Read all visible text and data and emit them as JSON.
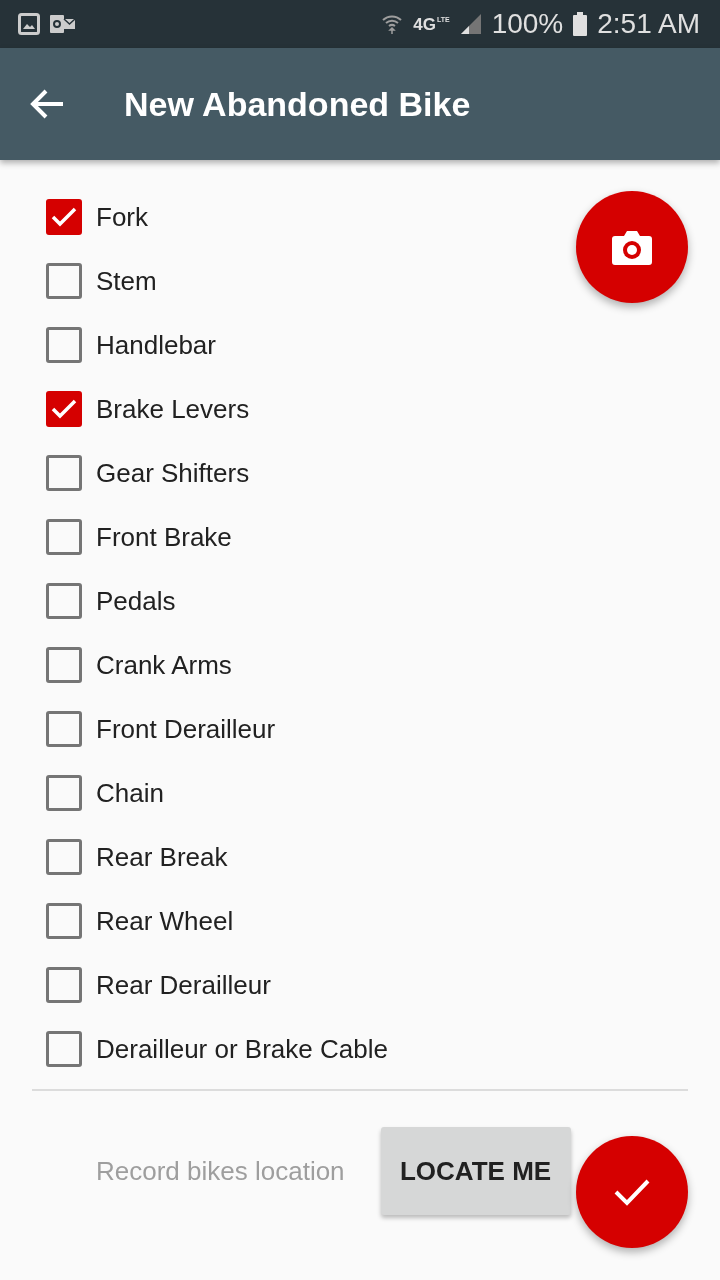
{
  "status_bar": {
    "network": "4G",
    "network_sub": "LTE",
    "battery": "100%",
    "time": "2:51 AM"
  },
  "app_bar": {
    "title": "New Abandoned Bike"
  },
  "parts": [
    {
      "label": "Fork",
      "checked": true
    },
    {
      "label": "Stem",
      "checked": false
    },
    {
      "label": "Handlebar",
      "checked": false
    },
    {
      "label": "Brake Levers",
      "checked": true
    },
    {
      "label": "Gear Shifters",
      "checked": false
    },
    {
      "label": "Front Brake",
      "checked": false
    },
    {
      "label": "Pedals",
      "checked": false
    },
    {
      "label": "Crank Arms",
      "checked": false
    },
    {
      "label": "Front Derailleur",
      "checked": false
    },
    {
      "label": "Chain",
      "checked": false
    },
    {
      "label": "Rear Break",
      "checked": false
    },
    {
      "label": "Rear Wheel",
      "checked": false
    },
    {
      "label": "Rear Derailleur",
      "checked": false
    },
    {
      "label": "Derailleur or Brake Cable",
      "checked": false
    }
  ],
  "location": {
    "hint": "Record bikes location",
    "button": "LOCATE ME"
  }
}
